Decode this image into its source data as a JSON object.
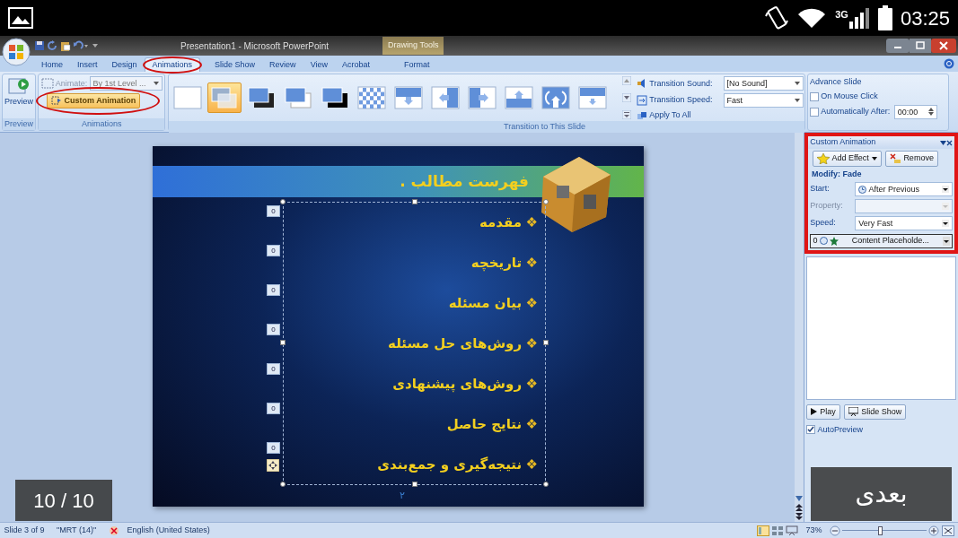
{
  "device_status": {
    "network": "3G",
    "time": "03:25"
  },
  "window": {
    "title": "Presentation1 - Microsoft PowerPoint",
    "contextual_tab": "Drawing Tools"
  },
  "tabs": [
    {
      "label": "Home",
      "selected": false,
      "circled": false
    },
    {
      "label": "Insert",
      "selected": false,
      "circled": false
    },
    {
      "label": "Design",
      "selected": false,
      "circled": false
    },
    {
      "label": "Animations",
      "selected": true,
      "circled": true
    },
    {
      "label": "Slide Show",
      "selected": false,
      "circled": false
    },
    {
      "label": "Review",
      "selected": false,
      "circled": false
    },
    {
      "label": "View",
      "selected": false,
      "circled": false
    },
    {
      "label": "Acrobat",
      "selected": false,
      "circled": false
    },
    {
      "label": "Format",
      "selected": false,
      "circled": false
    }
  ],
  "ribbon": {
    "preview": {
      "button": "Preview",
      "group": "Preview"
    },
    "animations": {
      "animate_label": "Animate:",
      "animate_value": "By 1st Level ...",
      "custom_animation": "Custom Animation",
      "circled": true,
      "group": "Animations"
    },
    "transitions": {
      "group": "Transition to This Slide",
      "thumbnails": [
        {
          "kind": "blank",
          "selected": false
        },
        {
          "kind": "fade",
          "selected": true
        },
        {
          "kind": "fade-dark",
          "selected": false
        },
        {
          "kind": "cut",
          "selected": false
        },
        {
          "kind": "cut-black",
          "selected": false
        },
        {
          "kind": "dissolve",
          "selected": false
        },
        {
          "kind": "push-down",
          "selected": false
        },
        {
          "kind": "push-left",
          "selected": false
        },
        {
          "kind": "push-right",
          "selected": false
        },
        {
          "kind": "push-up",
          "selected": false
        },
        {
          "kind": "wheel",
          "selected": false
        },
        {
          "kind": "wipe-down",
          "selected": false
        }
      ]
    },
    "transition_sound": {
      "label": "Transition Sound:",
      "value": "[No Sound]"
    },
    "transition_speed": {
      "label": "Transition Speed:",
      "value": "Fast"
    },
    "apply_to_all": "Apply To All",
    "advance_slide": {
      "title": "Advance Slide",
      "on_mouse_click": {
        "label": "On Mouse Click",
        "checked": false
      },
      "automatically_after": {
        "label": "Automatically After:",
        "checked": false,
        "value": "00:00"
      }
    }
  },
  "slide": {
    "title": "فهرست مطالب .",
    "page_number": "۲",
    "bullets": [
      {
        "marker": "❖",
        "text": "مقدمه",
        "order": "0"
      },
      {
        "marker": "❖",
        "text": "تاریخچه",
        "order": "0"
      },
      {
        "marker": "❖",
        "text": "بیان مسئله",
        "order": "0"
      },
      {
        "marker": "❖",
        "text": "روش‌های حل مسئله",
        "order": "0"
      },
      {
        "marker": "❖",
        "text": "روش‌های پیشنهادی",
        "order": "0"
      },
      {
        "marker": "❖",
        "text": "نتایج حاصل",
        "order": "0"
      },
      {
        "marker": "❖",
        "text": "نتیجه‌گیری و جمع‌بندی",
        "order": "0"
      }
    ]
  },
  "custom_animation_pane": {
    "title": "Custom Animation",
    "highlighted": true,
    "add_effect": "Add Effect",
    "remove": "Remove",
    "modify": "Modify: Fade",
    "fields": [
      {
        "label": "Start:",
        "value": "After Previous",
        "disabled": false,
        "kind": "clock"
      },
      {
        "label": "Property:",
        "disabled": true,
        "kind": "plain"
      },
      {
        "label": "Speed:",
        "value": "Very Fast",
        "disabled": false,
        "kind": "plain"
      }
    ],
    "items": [
      {
        "order": "0",
        "name": "Content Placeholde...",
        "selected": true
      }
    ],
    "play": "Play",
    "slide_show": "Slide Show",
    "autopreview": {
      "label": "AutoPreview",
      "checked": true
    }
  },
  "status_bar": {
    "slide": "Slide 3 of 9",
    "theme": "\"MRT (14)\"",
    "language": "English (United States)",
    "zoom": "73%",
    "zoom_slider": {
      "level": 0.45
    }
  },
  "viewer": {
    "counter": "10 / 10",
    "next_button": "بعدی"
  }
}
